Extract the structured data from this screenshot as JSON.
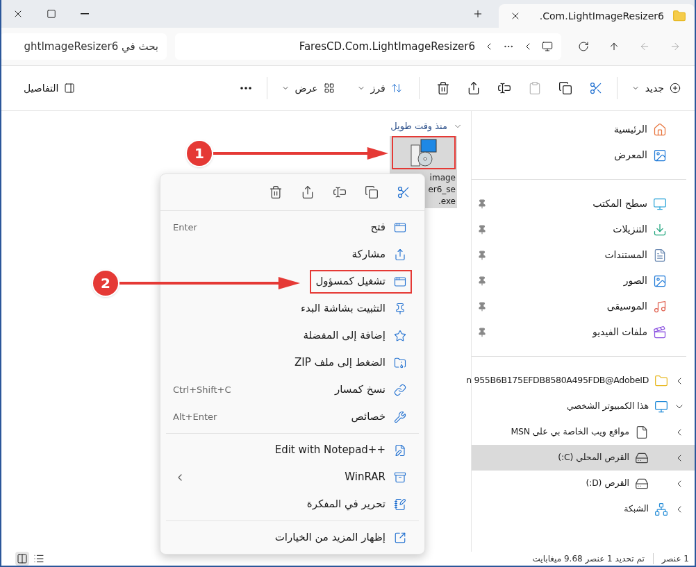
{
  "window": {
    "tab_title": ".Com.LightImageResizer6"
  },
  "address_bar": {
    "path": "FaresCD.Com.LightImageResizer6"
  },
  "search": {
    "placeholder": "بحث في ghtImageResizer6"
  },
  "toolbar": {
    "new_label": "جديد",
    "actions": [
      {
        "disabled": false
      },
      {
        "disabled": false
      },
      {
        "disabled": true
      },
      {
        "disabled": false
      },
      {
        "disabled": false
      },
      {
        "disabled": false
      }
    ],
    "sort_label": "فرز",
    "view_label": "عرض",
    "details_label": "التفاصيل"
  },
  "content": {
    "group_header": "منذ وقت طويل",
    "file": {
      "name_lines": [
        "image",
        "er6_se",
        ".exe"
      ],
      "selected": true,
      "marked": true
    }
  },
  "annotations": [
    {
      "label": "1"
    },
    {
      "label": "2"
    }
  ],
  "context_menu": {
    "quick_actions": [
      {
        "disabled": false
      },
      {
        "disabled": false
      },
      {
        "disabled": false
      },
      {
        "disabled": false
      },
      {
        "disabled": false
      }
    ],
    "sections": [
      [
        {
          "label": "فتح",
          "shortcut": "Enter",
          "has_submenu": false,
          "marked": false
        },
        {
          "label": "مشاركة",
          "has_submenu": false,
          "marked": false
        },
        {
          "label": "تشغيل كمسؤول",
          "has_submenu": false,
          "marked": true
        },
        {
          "label": "التثبيت بشاشة البدء",
          "has_submenu": false,
          "marked": false
        },
        {
          "label": "إضافة إلى المفضلة",
          "has_submenu": false,
          "marked": false
        },
        {
          "label": "الضغط إلى ملف ZIP",
          "has_submenu": false,
          "marked": false
        },
        {
          "label": "نسخ كمسار",
          "shortcut": "Ctrl+Shift+C",
          "has_submenu": false,
          "marked": false
        },
        {
          "label": "خصائص",
          "shortcut": "Alt+Enter",
          "has_submenu": false,
          "marked": false
        }
      ],
      [
        {
          "label": "Edit with Notepad++",
          "has_submenu": false,
          "marked": false
        },
        {
          "label": "WinRAR",
          "has_submenu": true,
          "marked": false
        },
        {
          "label": "تحرير في المفكرة",
          "has_submenu": false,
          "marked": false
        }
      ],
      [
        {
          "label": "إظهار المزيد من الخيارات",
          "has_submenu": false,
          "marked": false
        }
      ]
    ]
  },
  "sidebar": {
    "top_items": [
      {
        "label": "الرئيسية",
        "selected": false
      },
      {
        "label": "المعرض",
        "selected": false
      }
    ],
    "pinned_items": [
      {
        "label": "سطح المكتب",
        "pinned": true
      },
      {
        "label": "التنزيلات",
        "pinned": true
      },
      {
        "label": "المستندات",
        "pinned": true
      },
      {
        "label": "الصور",
        "pinned": true
      },
      {
        "label": "الموسيقى",
        "pinned": true
      },
      {
        "label": "ملفات الفيديو",
        "pinned": true
      }
    ],
    "tree": [
      {
        "label": "n 955B6B175EFDB8580A495FDB@AdobeID",
        "expanded": false,
        "selected": false
      },
      {
        "label": "هذا الكمبيوتر الشخصي",
        "expanded": true,
        "selected": false,
        "children": [
          {
            "label": "مواقع ويب الخاصة بي على MSN",
            "expanded": false,
            "selected": false
          },
          {
            "label": "القرص المحلي (C:)",
            "expanded": false,
            "selected": true
          },
          {
            "label": "القرص (D:)",
            "expanded": false,
            "selected": false
          }
        ]
      },
      {
        "label": "الشبكة",
        "expanded": false,
        "selected": false
      }
    ]
  },
  "status_bar": {
    "count": "1 عنصر",
    "selection": "تم تحديد 1 عنصر  9.68 ميغابايت",
    "views": [
      {
        "selected": false
      },
      {
        "selected": true
      }
    ]
  }
}
